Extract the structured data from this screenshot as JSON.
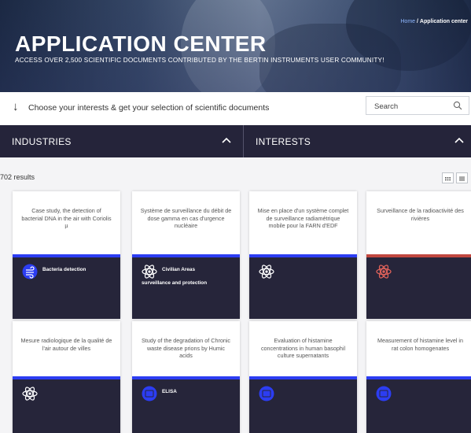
{
  "breadcrumb": {
    "home": "Home",
    "separator": "/",
    "current": "Application center"
  },
  "hero": {
    "title": "APPLICATION CENTER",
    "subtitle": "ACCESS OVER 2,500 SCIENTIFIC DOCUMENTS CONTRIBUTED BY THE BERTIN INSTRUMENTS USER COMMUNITY!"
  },
  "filter_intro": {
    "arrow": "↓",
    "text": "Choose your interests & get your selection of scientific documents"
  },
  "search": {
    "placeholder": "Search",
    "icon": "search-icon"
  },
  "filters": [
    {
      "label": "INDUSTRIES",
      "icon": "chevron-up-icon"
    },
    {
      "label": "INTERESTS",
      "icon": "chevron-up-icon"
    }
  ],
  "results": {
    "count_text": "702 results"
  },
  "view_toggle": {
    "grid_icon": "grid-view-icon",
    "list_icon": "list-view-icon"
  },
  "colors": {
    "accent_blue": "#2c3df2",
    "accent_red": "#c0473f",
    "dark": "#26253a",
    "link": "#8fb7ff"
  },
  "cards": [
    {
      "title": "Case study, the detection of bacterial DNA in the air with Coriolis µ",
      "icon": "air-flow-icon",
      "icon_color": "#2c3df2",
      "tag": "Bacteria detection",
      "tag2": "",
      "band": "blue"
    },
    {
      "title": "Système de surveillance du débit de dose gamma en cas d'urgence nucléaire",
      "icon": "atom-icon",
      "icon_color": "#ffffff",
      "tag": "Civilian Areas",
      "tag2": "surveillance and protection",
      "band": "blue"
    },
    {
      "title": "Mise en place d'un système complet de surveillance radiamétrique mobile pour la FARN d'EDF",
      "icon": "atom-icon",
      "icon_color": "#ffffff",
      "tag": "",
      "tag2": "",
      "band": "blue"
    },
    {
      "title": "Surveillance de la radioactivité des rivières",
      "icon": "atom-icon",
      "icon_color": "#e0625a",
      "tag": "",
      "tag2": "",
      "band": "red"
    },
    {
      "title": "Mesure radiologique de la qualité de l'air autour de villes",
      "icon": "atom-icon",
      "icon_color": "#ffffff",
      "tag": "",
      "tag2": "",
      "band": "blue"
    },
    {
      "title": "Study of the degradation of Chronic waste disease prions by Humic acids",
      "icon": "plate-icon",
      "icon_color": "#2c3df2",
      "tag": "ELISA",
      "tag2": "",
      "band": "blue"
    },
    {
      "title": "Evaluation of histamine concentrations in human basophil culture supernatants",
      "icon": "plate-icon",
      "icon_color": "#2c3df2",
      "tag": "",
      "tag2": "",
      "band": "blue"
    },
    {
      "title": "Measurement of histamine level in rat colon homogenates",
      "icon": "plate-icon",
      "icon_color": "#2c3df2",
      "tag": "",
      "tag2": "",
      "band": "blue"
    }
  ]
}
